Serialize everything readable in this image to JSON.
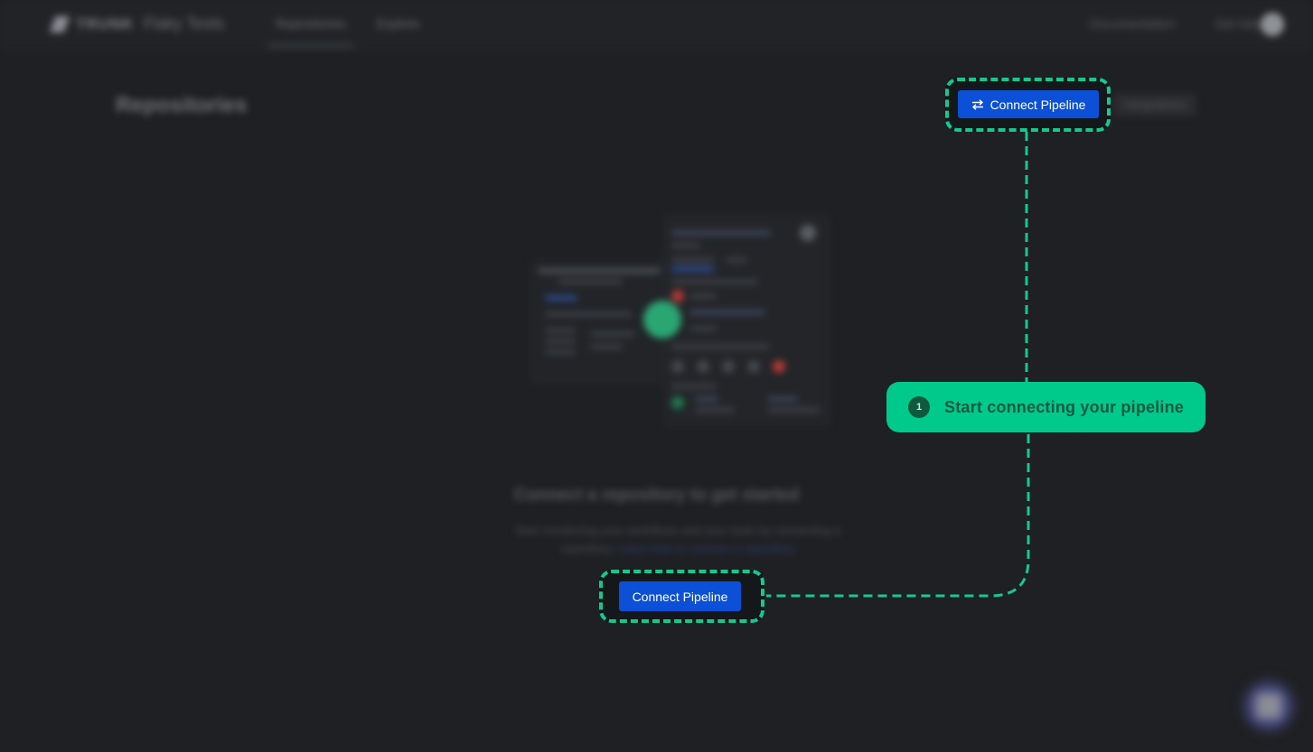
{
  "topbar": {
    "brand": "TRUNK",
    "product": "Flaky Tests",
    "nav": [
      {
        "label": "Repositories",
        "active": true
      },
      {
        "label": "Explore",
        "active": false
      }
    ],
    "right_links": [
      "Documentation",
      "Get help"
    ],
    "avatar_icon": "user-avatar"
  },
  "page": {
    "title": "Repositories",
    "integrations_label": "Integrations"
  },
  "empty_state": {
    "title": "Connect a repository to get started",
    "description": "Start monitoring your workflows and your tests by connecting a repository.",
    "link": "Learn how to connect a repository"
  },
  "onboarding": {
    "header_button_label": "Connect Pipeline",
    "header_button_icon": "swap-arrows-icon",
    "center_button_label": "Connect Pipeline",
    "tooltip": {
      "step": "1",
      "text": "Start connecting your pipeline"
    },
    "accent_color": "#00c98c",
    "button_color": "#0b50d6"
  },
  "chat": {
    "icon": "chat-icon"
  }
}
